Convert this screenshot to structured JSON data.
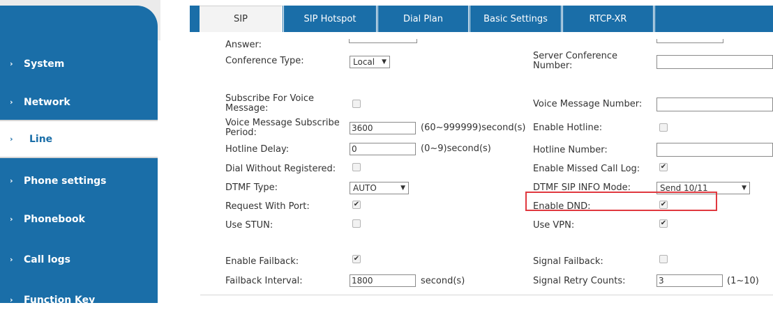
{
  "sidebar": {
    "items": [
      {
        "label": "System"
      },
      {
        "label": "Network"
      },
      {
        "label": "Line"
      },
      {
        "label": "Phone settings"
      },
      {
        "label": "Phonebook"
      },
      {
        "label": "Call logs"
      },
      {
        "label": "Function Key"
      }
    ]
  },
  "tabs": [
    {
      "label": "SIP"
    },
    {
      "label": "SIP Hotspot"
    },
    {
      "label": "Dial Plan"
    },
    {
      "label": "Basic Settings"
    },
    {
      "label": "RTCP-XR"
    }
  ],
  "form": {
    "answer_label": "Answer:",
    "conference_type_label": "Conference Type:",
    "conference_type_value": "Local",
    "server_conference_number_label": "Server Conference Number:",
    "subscribe_voice_message_label": "Subscribe For Voice Message:",
    "voice_message_number_label": "Voice Message Number:",
    "voice_message_subscribe_period_label": "Voice Message Subscribe Period:",
    "voice_message_subscribe_period_value": "3600",
    "voice_message_subscribe_period_hint": "(60~999999)second(s)",
    "enable_hotline_label": "Enable Hotline:",
    "hotline_delay_label": "Hotline Delay:",
    "hotline_delay_value": "0",
    "hotline_delay_hint": "(0~9)second(s)",
    "hotline_number_label": "Hotline Number:",
    "dial_without_registered_label": "Dial Without Registered:",
    "enable_missed_call_log_label": "Enable Missed Call Log:",
    "dtmf_type_label": "DTMF Type:",
    "dtmf_type_value": "AUTO",
    "dtmf_sip_info_mode_label": "DTMF SIP INFO Mode:",
    "dtmf_sip_info_mode_value": "Send 10/11",
    "request_with_port_label": "Request With Port:",
    "enable_dnd_label": "Enable DND:",
    "use_stun_label": "Use STUN:",
    "use_vpn_label": "Use VPN:",
    "enable_failback_label": "Enable Failback:",
    "signal_failback_label": "Signal Failback:",
    "failback_interval_label": "Failback Interval:",
    "failback_interval_value": "1800",
    "failback_interval_unit": "second(s)",
    "signal_retry_counts_label": "Signal Retry Counts:",
    "signal_retry_counts_value": "3",
    "signal_retry_counts_hint": "(1~10)"
  },
  "checkboxes": {
    "subscribe_voice_message": false,
    "enable_hotline": false,
    "dial_without_registered": false,
    "enable_missed_call_log": true,
    "request_with_port": true,
    "enable_dnd": true,
    "use_stun": false,
    "use_vpn": true,
    "enable_failback": true,
    "signal_failback": false
  },
  "colors": {
    "sidebar_bg": "#1a6ea8",
    "tabbar_bg": "#1a6ea8",
    "highlight_box": "#e0383f"
  },
  "icons": {
    "sidebar_item_arrow": "chevron-right-icon",
    "select_arrow": "triangle-down-icon",
    "checkbox_mark": "check-icon"
  }
}
